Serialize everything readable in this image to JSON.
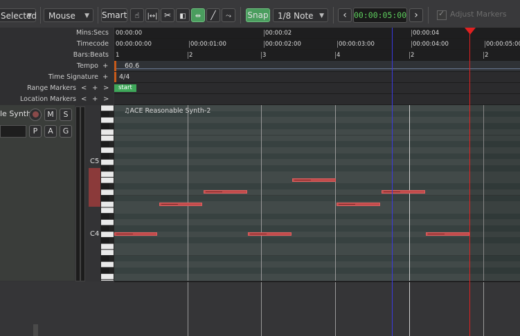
{
  "toolbar": {
    "selection_dropdown": "Selected",
    "edit_point_dropdown": "Mouse",
    "smart_label": "Smart",
    "snap_label": "Snap",
    "grid_dropdown": "1/8 Note",
    "nudge_clock": "00:00:05:00",
    "adjust_markers_label": "Adjust Markers"
  },
  "rulers": {
    "mins_secs_label": "Mins:Secs",
    "timecode_label": "Timecode",
    "bars_beats_label": "Bars:Beats",
    "tempo_label": "Tempo",
    "time_signature_label": "Time Signature",
    "range_markers_label": "Range Markers",
    "location_markers_label": "Location Markers",
    "plus": "+",
    "lt": "<",
    "gt": ">",
    "mins_ticks": [
      "00:00:00",
      "00:00:02",
      "00:00:04"
    ],
    "timecode_ticks": [
      "00:00:00:00",
      "00:00:01:00",
      "00:00:02:00",
      "00:00:03:00",
      "00:00:04:00",
      "00:00:05:00"
    ],
    "bar_ticks": [
      "1",
      "2",
      "3",
      "4",
      "2",
      "2"
    ],
    "tempo_value": "60.6",
    "time_signature_value": "4/4",
    "range_start": "start"
  },
  "track": {
    "name": "le Synth",
    "mute": "M",
    "solo": "S",
    "playlist": "P",
    "automation": "A",
    "group": "G"
  },
  "piano": {
    "c5_label": "C5",
    "c4_label": "C4"
  },
  "region": {
    "name": "♫ACE Reasonable Synth-2"
  },
  "colors": {
    "playhead": "#e02020",
    "edit_point": "#3a3ae0",
    "note": "#c24b4b",
    "snap_active": "#4a9d5e",
    "clock_text": "#5fd05f"
  }
}
